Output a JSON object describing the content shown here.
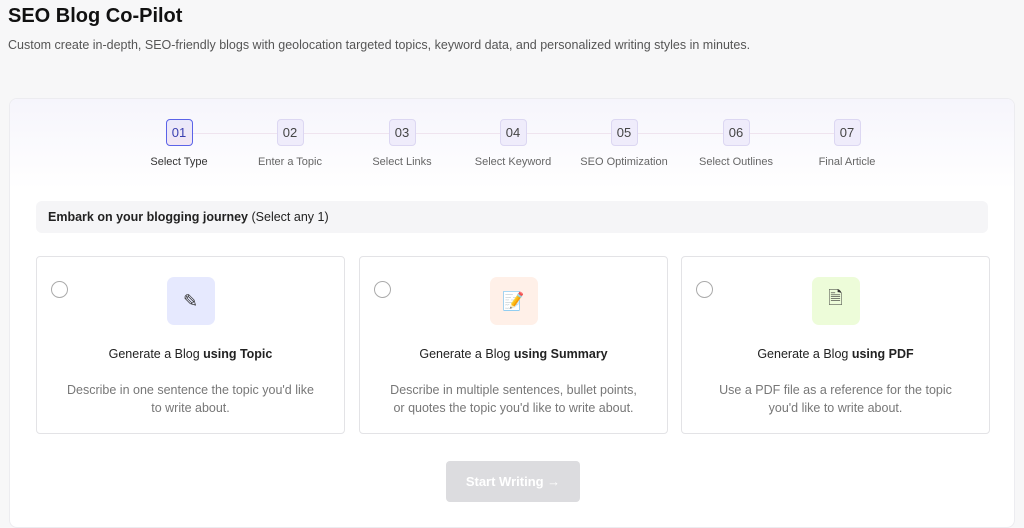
{
  "header": {
    "title": "SEO Blog Co-Pilot",
    "subtitle": "Custom create in-depth, SEO-friendly blogs with geolocation targeted topics, keyword data, and personalized writing styles in minutes."
  },
  "steps": [
    {
      "num": "01",
      "label": "Select Type",
      "active": true
    },
    {
      "num": "02",
      "label": "Enter a Topic"
    },
    {
      "num": "03",
      "label": "Select Links"
    },
    {
      "num": "04",
      "label": "Select Keyword"
    },
    {
      "num": "05",
      "label": "SEO Optimization"
    },
    {
      "num": "06",
      "label": "Select Outlines"
    },
    {
      "num": "07",
      "label": "Final Article"
    }
  ],
  "banner": {
    "bold": "Embark on your blogging journey",
    "note": "(Select any 1)"
  },
  "cards": [
    {
      "prefix": "Generate a Blog ",
      "bold": "using Topic",
      "desc": "Describe in one sentence the topic you'd like to write about.",
      "icon": "chat-edit-icon",
      "color": "#e6e9fe"
    },
    {
      "prefix": "Generate a Blog ",
      "bold": "using Summary",
      "desc": "Describe in multiple sentences, bullet points, or quotes the topic you'd like to write about.",
      "icon": "document-edit-icon",
      "color": "#fff0e8"
    },
    {
      "prefix": "Generate a Blog ",
      "bold": "using PDF",
      "desc": "Use a PDF file as a reference for the topic you'd like to write about.",
      "icon": "pdf-file-icon",
      "color": "#edfcd9"
    }
  ],
  "button": {
    "label": "Start Writing →"
  }
}
